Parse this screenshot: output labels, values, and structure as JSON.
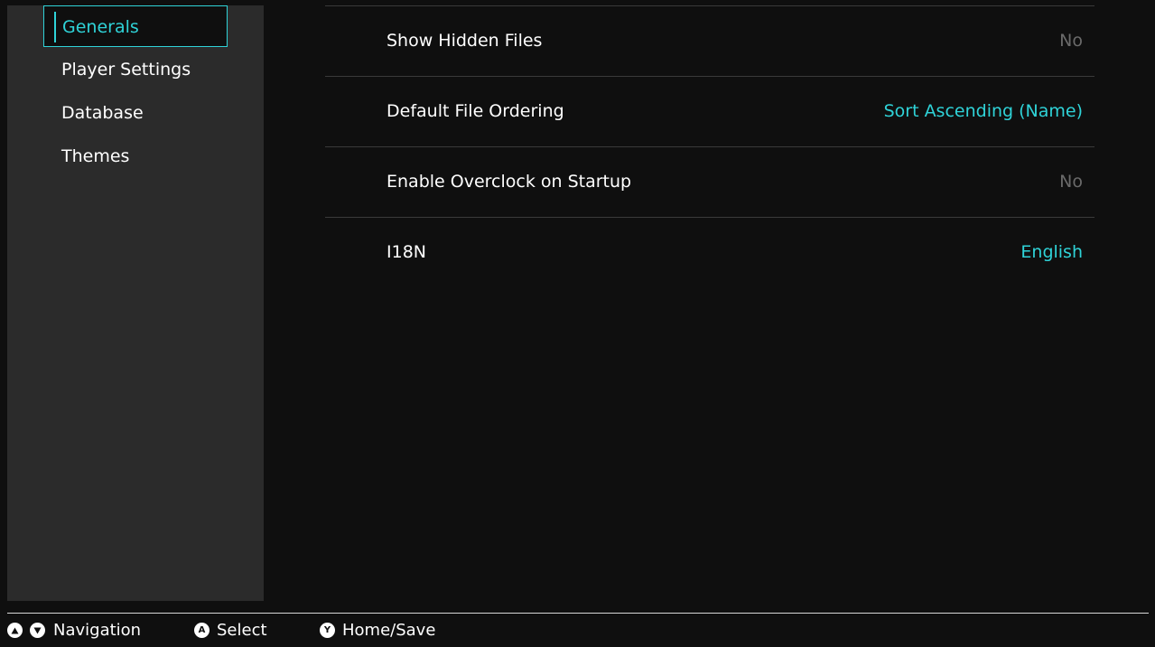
{
  "sidebar": {
    "items": [
      {
        "label": "Generals",
        "selected": true
      },
      {
        "label": "Player Settings",
        "selected": false
      },
      {
        "label": "Database",
        "selected": false
      },
      {
        "label": "Themes",
        "selected": false
      }
    ]
  },
  "settings": {
    "rows": [
      {
        "label": "Show Hidden Files",
        "value": "No"
      },
      {
        "label": "Default File Ordering",
        "value": "Sort Ascending (Name)"
      },
      {
        "label": "Enable Overclock on Startup",
        "value": "No"
      },
      {
        "label": "I18N",
        "value": "English"
      }
    ]
  },
  "footer": {
    "navigation": {
      "label": "Navigation",
      "icons": [
        "dpad-up-icon",
        "dpad-down-icon"
      ]
    },
    "select": {
      "label": "Select",
      "button": "A"
    },
    "home": {
      "label": "Home/Save",
      "button": "Y"
    }
  },
  "colors": {
    "accent": "#2fd3d8",
    "background": "#0f0f0f",
    "sidebar": "#2b2b2b",
    "value_disabled": "#6a6a6a"
  }
}
